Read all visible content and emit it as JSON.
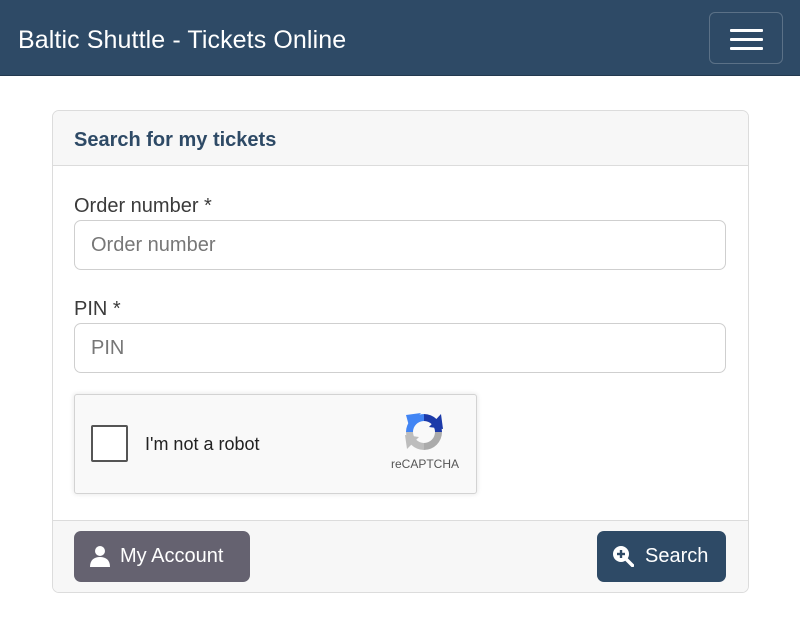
{
  "navbar": {
    "brand": "Baltic Shuttle - Tickets Online",
    "menu_icon": "hamburger-menu-icon"
  },
  "card": {
    "title": "Search for my tickets",
    "order_number": {
      "label": "Order number *",
      "placeholder": "Order number",
      "value": ""
    },
    "pin": {
      "label": "PIN *",
      "placeholder": "PIN",
      "value": ""
    },
    "captcha": {
      "text": "I'm not a robot",
      "brand": "reCAPTCHA",
      "checked": false,
      "logo_icon": "recaptcha-logo-icon"
    }
  },
  "footer": {
    "account_button": {
      "label": "My Account",
      "icon": "user-icon"
    },
    "search_button": {
      "label": "Search",
      "icon": "search-plus-icon"
    }
  },
  "colors": {
    "primary": "#2e4a66",
    "secondary": "#656270",
    "header_bg": "#f7f7f7"
  }
}
